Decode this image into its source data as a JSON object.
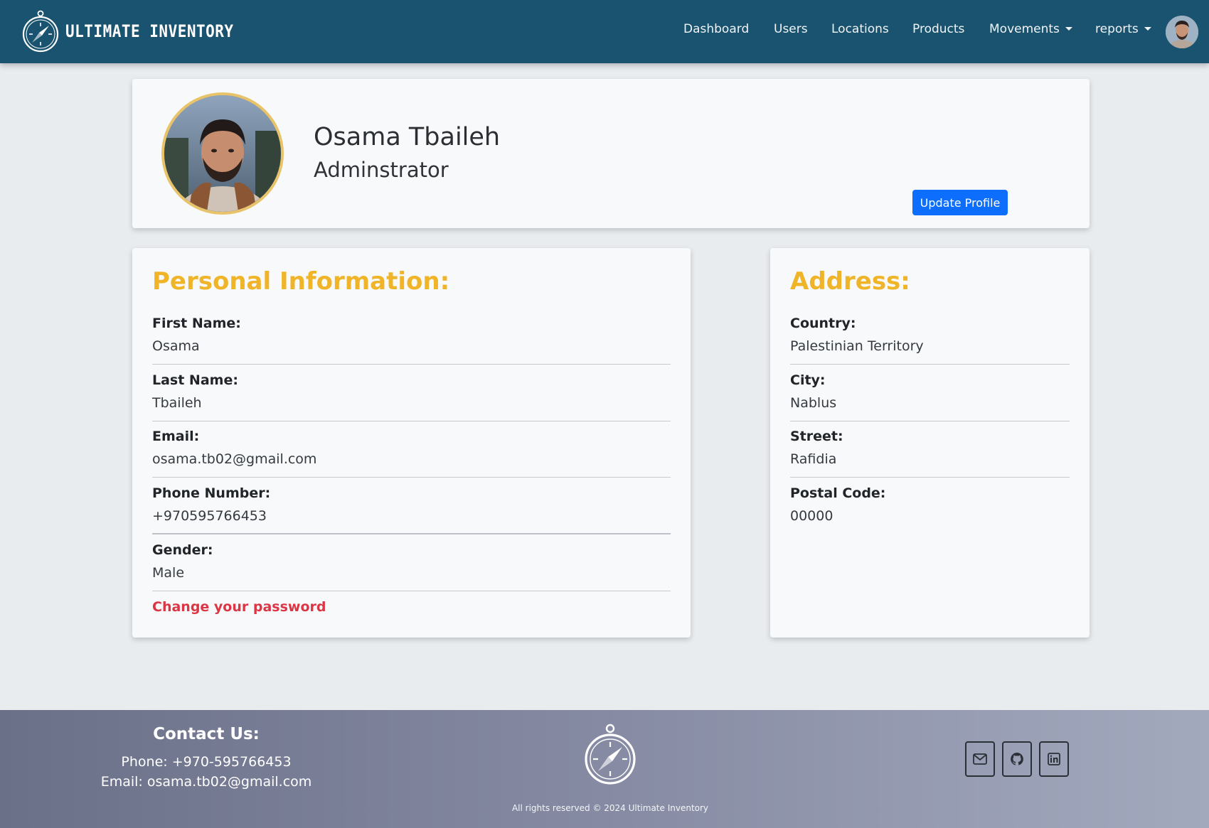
{
  "navbar": {
    "brand": "ULTIMATE INVENTORY",
    "links": [
      {
        "label": "Dashboard"
      },
      {
        "label": "Users"
      },
      {
        "label": "Locations"
      },
      {
        "label": "Products"
      },
      {
        "label": "Movements",
        "dropdown": true
      },
      {
        "label": "reports",
        "dropdown": true
      }
    ],
    "avatar_icon": "user-avatar-icon"
  },
  "profile": {
    "name": "Osama Tbaileh",
    "role": "Adminstrator",
    "update_button": "Update Profile"
  },
  "personal": {
    "title": "Personal Information:",
    "fields": [
      {
        "label": "First Name:",
        "value": "Osama"
      },
      {
        "label": "Last Name:",
        "value": "Tbaileh"
      },
      {
        "label": "Email:",
        "value": "osama.tb02@gmail.com"
      },
      {
        "label": "Phone Number:",
        "value": "+970595766453"
      },
      {
        "label": "Gender:",
        "value": "Male"
      }
    ],
    "change_password": "Change your password"
  },
  "address": {
    "title": "Address:",
    "fields": [
      {
        "label": "Country:",
        "value": "Palestinian Territory"
      },
      {
        "label": "City:",
        "value": "Nablus"
      },
      {
        "label": "Street:",
        "value": "Rafidia"
      },
      {
        "label": "Postal Code:",
        "value": "00000"
      }
    ]
  },
  "footer": {
    "contact_title": "Contact Us:",
    "phone": "Phone: +970-595766453",
    "email": "Email: osama.tb02@gmail.com",
    "copyright": "All rights reserved © 2024 Ultimate Inventory",
    "social": [
      "mail-icon",
      "github-icon",
      "linkedin-icon"
    ]
  },
  "colors": {
    "navbar": "#1a5370",
    "accent_title": "#f0b429",
    "primary_button": "#0d6efd",
    "danger_link": "#dc3545"
  }
}
